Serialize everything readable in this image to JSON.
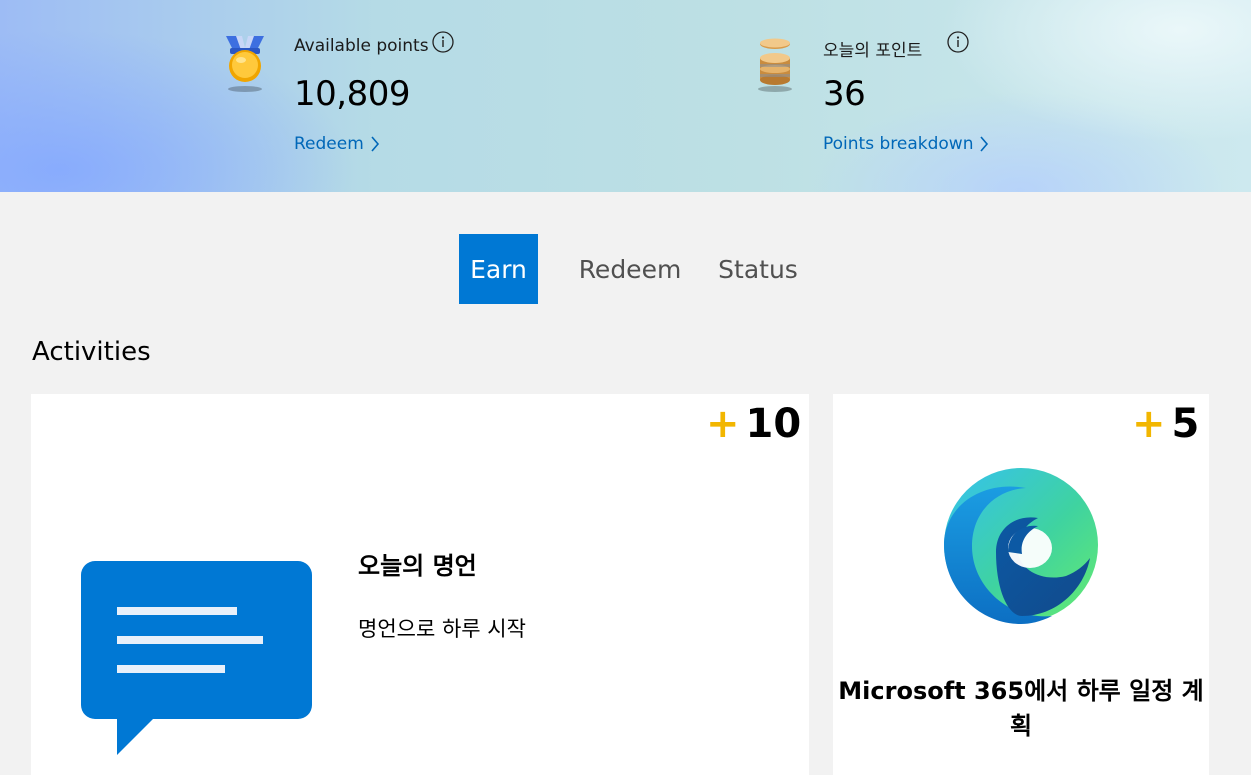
{
  "summary": {
    "available": {
      "label": "Available points",
      "value": "10,809",
      "link": "Redeem",
      "icon": "medal-icon"
    },
    "today": {
      "label": "오늘의 포인트",
      "value": "36",
      "link": "Points breakdown",
      "icon": "coin-stack-icon"
    }
  },
  "tabs": [
    {
      "label": "Earn",
      "active": true
    },
    {
      "label": "Redeem",
      "active": false
    },
    {
      "label": "Status",
      "active": false
    }
  ],
  "section": {
    "title": "Activities"
  },
  "cards": [
    {
      "points_plus": "+",
      "points": "10",
      "title": "오늘의 명언",
      "description": "명언으로 하루 시작",
      "icon": "chat-message-icon"
    },
    {
      "points_plus": "+",
      "points": "5",
      "title": "Microsoft 365에서 하루 일정 계획",
      "icon": "edge-logo-icon"
    }
  ],
  "colors": {
    "accent": "#0078d4",
    "link": "#0067b8",
    "points_plus": "#f2b600"
  }
}
